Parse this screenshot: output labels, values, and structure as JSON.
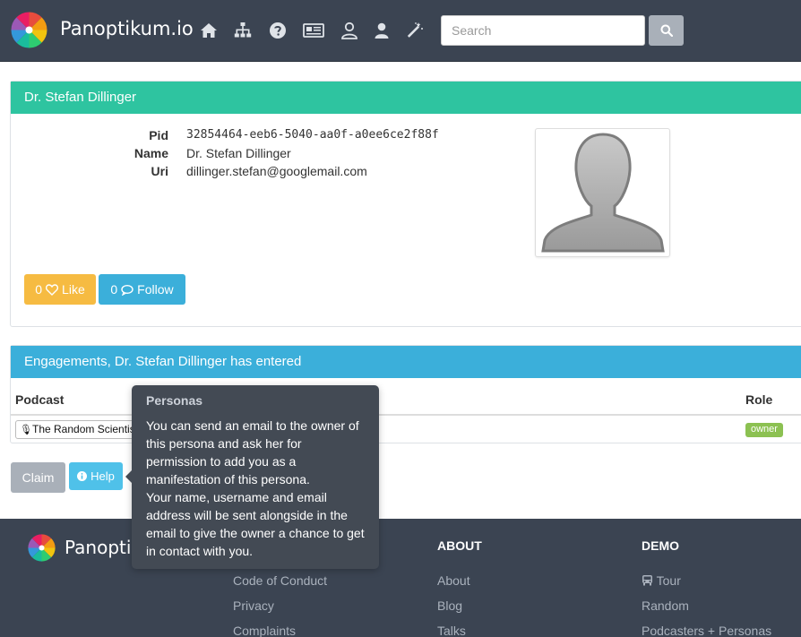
{
  "navbar": {
    "brand": "Panoptikum.io",
    "icons": [
      "home-icon",
      "sitemap-icon",
      "question-circle-icon",
      "newspaper-icon",
      "user-outline-icon",
      "user-icon",
      "magic-wand-icon"
    ],
    "search": {
      "placeholder": "Search",
      "value": ""
    },
    "search_button_icon": "search-icon"
  },
  "persona": {
    "header": "Dr. Stefan Dillinger",
    "fields": [
      {
        "label": "Pid",
        "value": "32854464-eeb6-5040-aa0f-a0ee6ce2f88f"
      },
      {
        "label": "Name",
        "value": "Dr. Stefan Dillinger"
      },
      {
        "label": "Uri",
        "value": "dillinger.stefan@googlemail.com"
      }
    ],
    "like": {
      "count": "0",
      "label": "Like"
    },
    "follow": {
      "count": "0",
      "label": "Follow"
    }
  },
  "engagements": {
    "header": "Engagements, Dr. Stefan Dillinger has entered",
    "columns": {
      "podcast": "Podcast",
      "role": "Role"
    },
    "rows": [
      {
        "podcast": "The Random Scientist",
        "role": "owner"
      }
    ]
  },
  "actions": {
    "claim": "Claim",
    "help": "Help"
  },
  "popover": {
    "title": "Personas",
    "body_lines": [
      "You can send an email to the owner of",
      "this persona and ask her for",
      "permission to add you as a",
      "manifestation of this persona.",
      "Your name, username and email",
      "address will be sent alongside in the",
      "email to give the owner a chance to get",
      "in contact with you."
    ]
  },
  "footer": {
    "brand": "Panoptikum.io",
    "col1": {
      "links": [
        "Code of Conduct",
        "Privacy",
        "Complaints"
      ]
    },
    "col2": {
      "heading": "ABOUT",
      "links": [
        "About",
        "Blog",
        "Talks"
      ]
    },
    "col3": {
      "heading": "DEMO",
      "links": [
        "Tour",
        "Random",
        "Podcasters + Personas"
      ]
    }
  },
  "colors": {
    "navbar": "#3b4452",
    "persona_header": "#2ec4a0",
    "engagement_header": "#3bafda",
    "like": "#f6bb42",
    "follow": "#3bafda",
    "claim": "#a9b0b9",
    "help": "#4fc1e9",
    "owner_badge": "#8cc152"
  }
}
